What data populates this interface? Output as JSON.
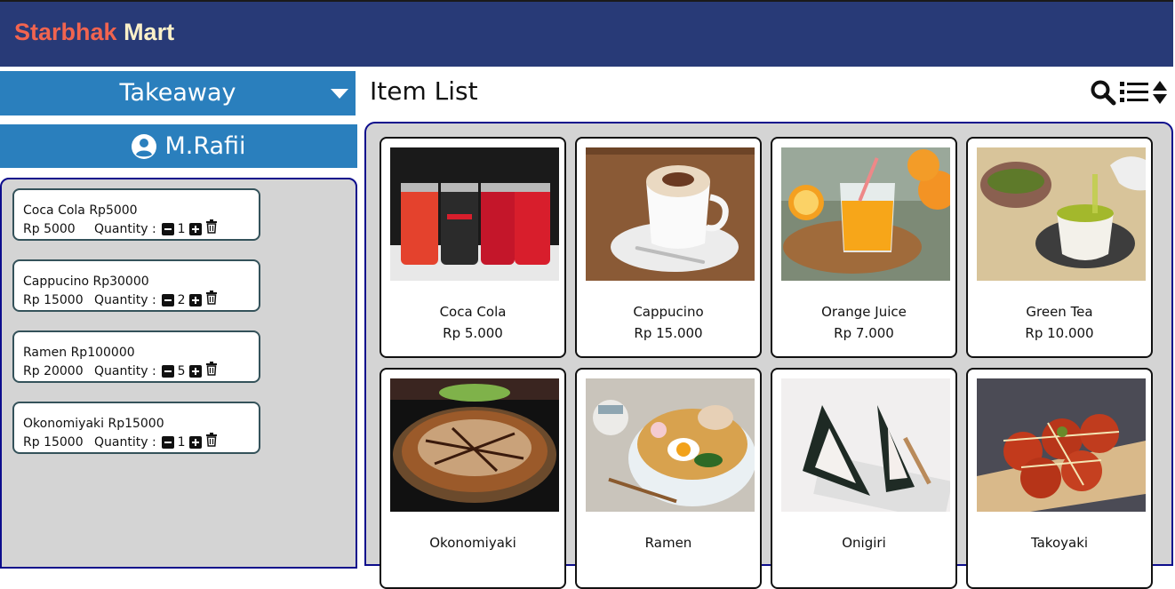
{
  "header": {
    "brand_part1": "Starbhak",
    "brand_part2": "Mart"
  },
  "order_type": {
    "selected": "Takeaway"
  },
  "user": {
    "name": "M.Rafii"
  },
  "cart": {
    "items": [
      {
        "title": "Coca Cola Rp5000",
        "price": "Rp 5000",
        "quantity_label": "Quantity :",
        "quantity": "1"
      },
      {
        "title": "Cappucino Rp30000",
        "price": "Rp 15000",
        "quantity_label": "Quantity :",
        "quantity": "2"
      },
      {
        "title": "Ramen Rp100000",
        "price": "Rp 20000",
        "quantity_label": "Quantity :",
        "quantity": "5"
      },
      {
        "title": "Okonomiyaki Rp15000",
        "price": "Rp 15000",
        "quantity_label": "Quantity :",
        "quantity": "1"
      }
    ]
  },
  "item_list": {
    "title": "Item List",
    "tools": [
      "search-icon",
      "list-icon",
      "sort-icon"
    ],
    "items": [
      {
        "name": "Coca Cola",
        "price": "Rp 5.000"
      },
      {
        "name": "Cappucino",
        "price": "Rp 15.000"
      },
      {
        "name": "Orange Juice",
        "price": "Rp 7.000"
      },
      {
        "name": "Green Tea",
        "price": "Rp 10.000"
      },
      {
        "name": "Okonomiyaki",
        "price": ""
      },
      {
        "name": "Ramen",
        "price": ""
      },
      {
        "name": "Onigiri",
        "price": ""
      },
      {
        "name": "Takoyaki",
        "price": ""
      }
    ]
  },
  "colors": {
    "header_bg": "#283a77",
    "brand_accent": "#f2644f",
    "brand_light": "#fbf0c8",
    "primary_blue": "#2a7fbd",
    "panel_border": "#0c0c8c",
    "panel_bg": "#d4d4d4"
  }
}
